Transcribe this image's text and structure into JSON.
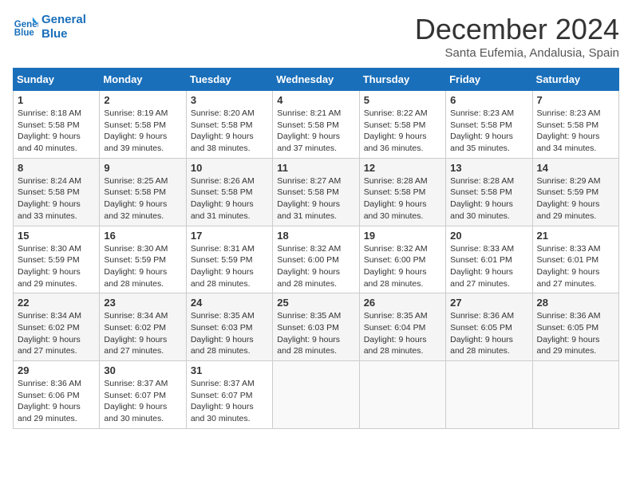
{
  "header": {
    "logo_line1": "General",
    "logo_line2": "Blue",
    "month": "December 2024",
    "location": "Santa Eufemia, Andalusia, Spain"
  },
  "weekdays": [
    "Sunday",
    "Monday",
    "Tuesday",
    "Wednesday",
    "Thursday",
    "Friday",
    "Saturday"
  ],
  "weeks": [
    [
      {
        "day": "1",
        "sunrise": "Sunrise: 8:18 AM",
        "sunset": "Sunset: 5:58 PM",
        "daylight": "Daylight: 9 hours and 40 minutes."
      },
      {
        "day": "2",
        "sunrise": "Sunrise: 8:19 AM",
        "sunset": "Sunset: 5:58 PM",
        "daylight": "Daylight: 9 hours and 39 minutes."
      },
      {
        "day": "3",
        "sunrise": "Sunrise: 8:20 AM",
        "sunset": "Sunset: 5:58 PM",
        "daylight": "Daylight: 9 hours and 38 minutes."
      },
      {
        "day": "4",
        "sunrise": "Sunrise: 8:21 AM",
        "sunset": "Sunset: 5:58 PM",
        "daylight": "Daylight: 9 hours and 37 minutes."
      },
      {
        "day": "5",
        "sunrise": "Sunrise: 8:22 AM",
        "sunset": "Sunset: 5:58 PM",
        "daylight": "Daylight: 9 hours and 36 minutes."
      },
      {
        "day": "6",
        "sunrise": "Sunrise: 8:23 AM",
        "sunset": "Sunset: 5:58 PM",
        "daylight": "Daylight: 9 hours and 35 minutes."
      },
      {
        "day": "7",
        "sunrise": "Sunrise: 8:23 AM",
        "sunset": "Sunset: 5:58 PM",
        "daylight": "Daylight: 9 hours and 34 minutes."
      }
    ],
    [
      {
        "day": "8",
        "sunrise": "Sunrise: 8:24 AM",
        "sunset": "Sunset: 5:58 PM",
        "daylight": "Daylight: 9 hours and 33 minutes."
      },
      {
        "day": "9",
        "sunrise": "Sunrise: 8:25 AM",
        "sunset": "Sunset: 5:58 PM",
        "daylight": "Daylight: 9 hours and 32 minutes."
      },
      {
        "day": "10",
        "sunrise": "Sunrise: 8:26 AM",
        "sunset": "Sunset: 5:58 PM",
        "daylight": "Daylight: 9 hours and 31 minutes."
      },
      {
        "day": "11",
        "sunrise": "Sunrise: 8:27 AM",
        "sunset": "Sunset: 5:58 PM",
        "daylight": "Daylight: 9 hours and 31 minutes."
      },
      {
        "day": "12",
        "sunrise": "Sunrise: 8:28 AM",
        "sunset": "Sunset: 5:58 PM",
        "daylight": "Daylight: 9 hours and 30 minutes."
      },
      {
        "day": "13",
        "sunrise": "Sunrise: 8:28 AM",
        "sunset": "Sunset: 5:58 PM",
        "daylight": "Daylight: 9 hours and 30 minutes."
      },
      {
        "day": "14",
        "sunrise": "Sunrise: 8:29 AM",
        "sunset": "Sunset: 5:59 PM",
        "daylight": "Daylight: 9 hours and 29 minutes."
      }
    ],
    [
      {
        "day": "15",
        "sunrise": "Sunrise: 8:30 AM",
        "sunset": "Sunset: 5:59 PM",
        "daylight": "Daylight: 9 hours and 29 minutes."
      },
      {
        "day": "16",
        "sunrise": "Sunrise: 8:30 AM",
        "sunset": "Sunset: 5:59 PM",
        "daylight": "Daylight: 9 hours and 28 minutes."
      },
      {
        "day": "17",
        "sunrise": "Sunrise: 8:31 AM",
        "sunset": "Sunset: 5:59 PM",
        "daylight": "Daylight: 9 hours and 28 minutes."
      },
      {
        "day": "18",
        "sunrise": "Sunrise: 8:32 AM",
        "sunset": "Sunset: 6:00 PM",
        "daylight": "Daylight: 9 hours and 28 minutes."
      },
      {
        "day": "19",
        "sunrise": "Sunrise: 8:32 AM",
        "sunset": "Sunset: 6:00 PM",
        "daylight": "Daylight: 9 hours and 28 minutes."
      },
      {
        "day": "20",
        "sunrise": "Sunrise: 8:33 AM",
        "sunset": "Sunset: 6:01 PM",
        "daylight": "Daylight: 9 hours and 27 minutes."
      },
      {
        "day": "21",
        "sunrise": "Sunrise: 8:33 AM",
        "sunset": "Sunset: 6:01 PM",
        "daylight": "Daylight: 9 hours and 27 minutes."
      }
    ],
    [
      {
        "day": "22",
        "sunrise": "Sunrise: 8:34 AM",
        "sunset": "Sunset: 6:02 PM",
        "daylight": "Daylight: 9 hours and 27 minutes."
      },
      {
        "day": "23",
        "sunrise": "Sunrise: 8:34 AM",
        "sunset": "Sunset: 6:02 PM",
        "daylight": "Daylight: 9 hours and 27 minutes."
      },
      {
        "day": "24",
        "sunrise": "Sunrise: 8:35 AM",
        "sunset": "Sunset: 6:03 PM",
        "daylight": "Daylight: 9 hours and 28 minutes."
      },
      {
        "day": "25",
        "sunrise": "Sunrise: 8:35 AM",
        "sunset": "Sunset: 6:03 PM",
        "daylight": "Daylight: 9 hours and 28 minutes."
      },
      {
        "day": "26",
        "sunrise": "Sunrise: 8:35 AM",
        "sunset": "Sunset: 6:04 PM",
        "daylight": "Daylight: 9 hours and 28 minutes."
      },
      {
        "day": "27",
        "sunrise": "Sunrise: 8:36 AM",
        "sunset": "Sunset: 6:05 PM",
        "daylight": "Daylight: 9 hours and 28 minutes."
      },
      {
        "day": "28",
        "sunrise": "Sunrise: 8:36 AM",
        "sunset": "Sunset: 6:05 PM",
        "daylight": "Daylight: 9 hours and 29 minutes."
      }
    ],
    [
      {
        "day": "29",
        "sunrise": "Sunrise: 8:36 AM",
        "sunset": "Sunset: 6:06 PM",
        "daylight": "Daylight: 9 hours and 29 minutes."
      },
      {
        "day": "30",
        "sunrise": "Sunrise: 8:37 AM",
        "sunset": "Sunset: 6:07 PM",
        "daylight": "Daylight: 9 hours and 30 minutes."
      },
      {
        "day": "31",
        "sunrise": "Sunrise: 8:37 AM",
        "sunset": "Sunset: 6:07 PM",
        "daylight": "Daylight: 9 hours and 30 minutes."
      },
      null,
      null,
      null,
      null
    ]
  ]
}
